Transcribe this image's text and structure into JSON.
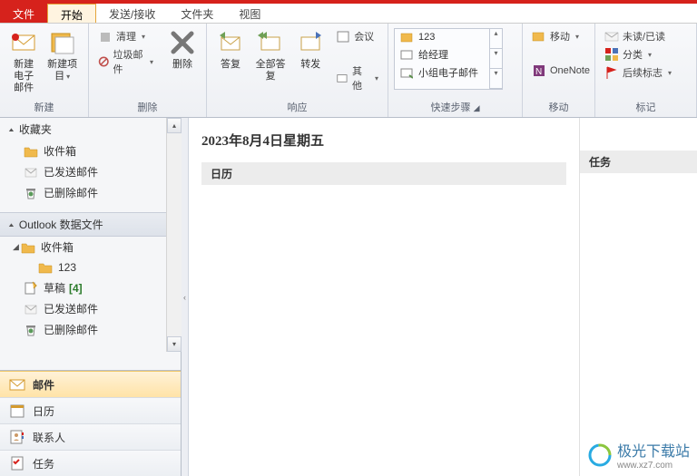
{
  "tabs": {
    "file": "文件",
    "home": "开始",
    "sendrecv": "发送/接收",
    "folder": "文件夹",
    "view": "视图"
  },
  "ribbon": {
    "new_mail": "新建\n电子邮件",
    "new_item": "新建项目",
    "group_new": "新建",
    "clean": "清理",
    "junk": "垃圾邮件",
    "delete": "删除",
    "group_delete": "删除",
    "reply": "答复",
    "reply_all": "全部答复",
    "forward": "转发",
    "meeting": "会议",
    "other": "其他",
    "group_respond": "响应",
    "qs_123": "123",
    "qs_manager": "给经理",
    "qs_team": "小组电子邮件",
    "group_quicksteps": "快速步骤",
    "move": "移动",
    "onenote": "OneNote",
    "group_move": "移动",
    "unread": "未读/已读",
    "categorize": "分类",
    "followup": "后续标志",
    "group_tags": "标记"
  },
  "sidebar": {
    "favorites": "收藏夹",
    "inbox": "收件箱",
    "sent": "已发送邮件",
    "deleted": "已删除邮件",
    "account": "Outlook 数据文件",
    "folder_123": "123",
    "drafts": "草稿",
    "drafts_count": "[4]"
  },
  "nav": {
    "mail": "邮件",
    "calendar": "日历",
    "contacts": "联系人",
    "tasks": "任务"
  },
  "content": {
    "date": "2023年8月4日星期五",
    "calendar": "日历",
    "tasks": "任务"
  },
  "watermark": {
    "name": "极光下载站",
    "url": "www.xz7.com"
  }
}
